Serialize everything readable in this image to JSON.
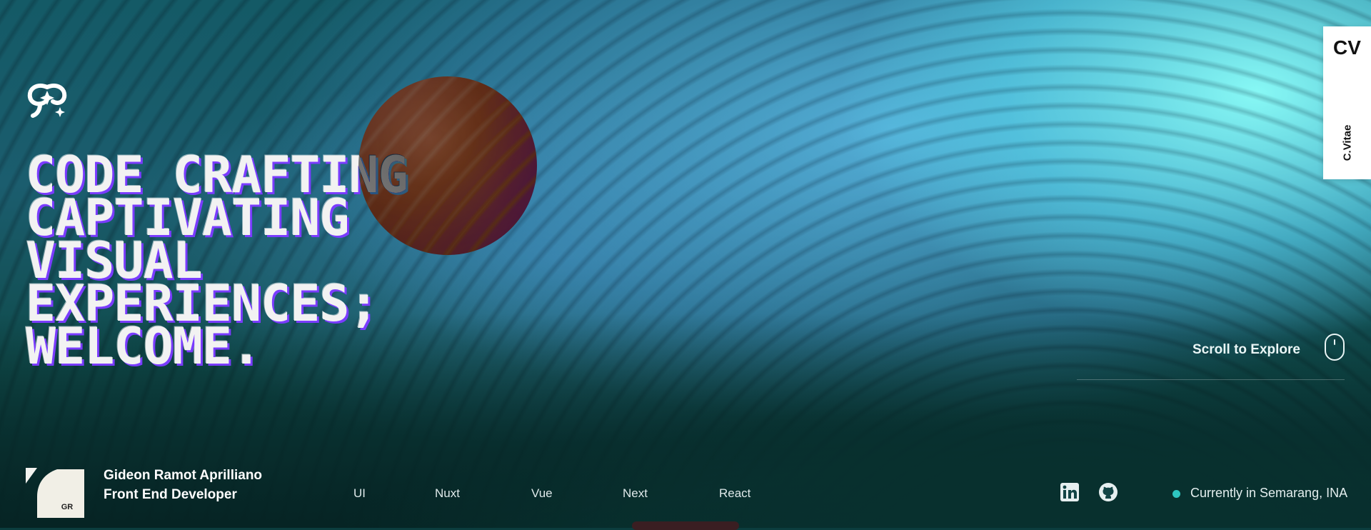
{
  "hero": {
    "lines": [
      "CODE CRAFTING",
      "CAPTIVATING",
      "VISUAL",
      "EXPERIENCES;",
      "WELCOME."
    ]
  },
  "cv_tab": {
    "title": "CV",
    "subtitle": "C.Vitae"
  },
  "scroll_hint": {
    "label": "Scroll to Explore"
  },
  "profile": {
    "avatar_text": "GR",
    "name": "Gideon Ramot Aprilliano",
    "role": "Front End Developer"
  },
  "nav": {
    "items": [
      "UI",
      "Nuxt",
      "Vue",
      "Next",
      "React"
    ]
  },
  "social": {
    "icons": [
      "linkedin-icon",
      "github-icon"
    ]
  },
  "status": {
    "text": "Currently in Semarang, INA",
    "dot_color": "#2ec6c1"
  }
}
